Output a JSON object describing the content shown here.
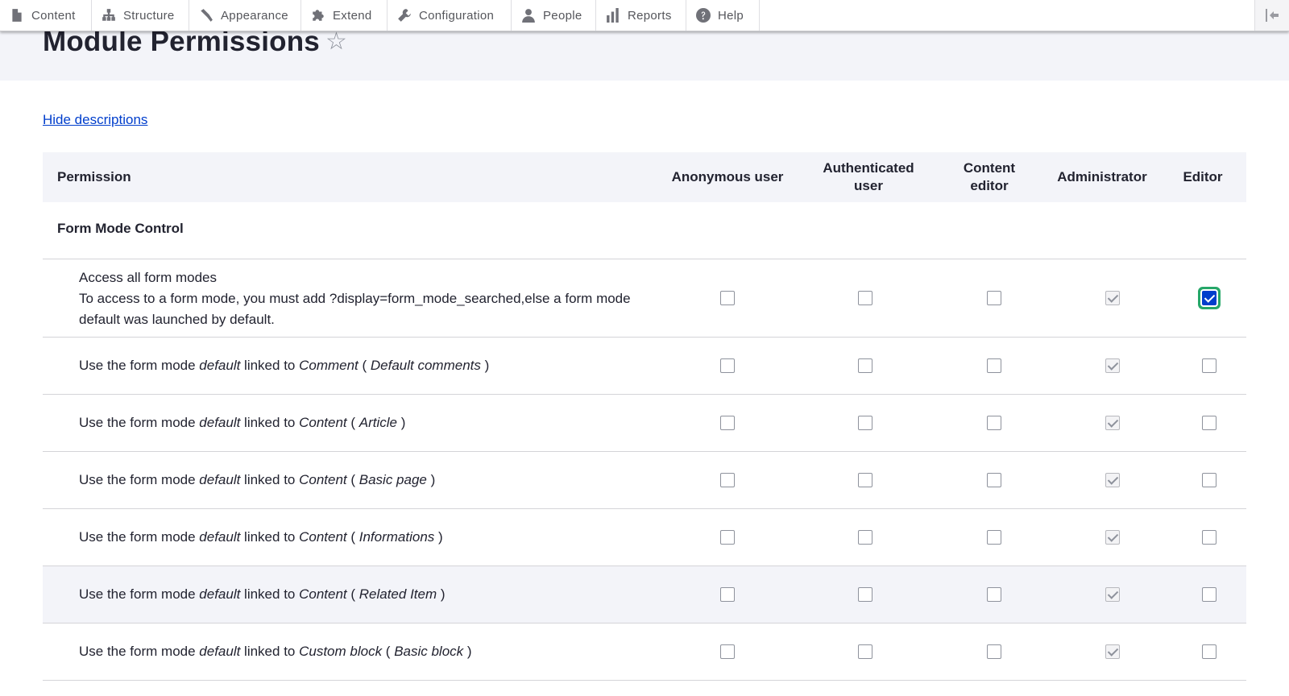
{
  "toolbar": {
    "items": [
      {
        "label": "Content",
        "icon": "file-icon"
      },
      {
        "label": "Structure",
        "icon": "sitemap-icon"
      },
      {
        "label": "Appearance",
        "icon": "brush-icon"
      },
      {
        "label": "Extend",
        "icon": "puzzle-icon"
      },
      {
        "label": "Configuration",
        "icon": "wrench-icon"
      },
      {
        "label": "People",
        "icon": "person-icon"
      },
      {
        "label": "Reports",
        "icon": "bar-chart-icon"
      },
      {
        "label": "Help",
        "icon": "help-icon"
      }
    ]
  },
  "page": {
    "title": "Module Permissions",
    "toggle_descriptions": "Hide descriptions"
  },
  "table": {
    "columns": {
      "permission": "Permission",
      "anonymous": "Anonymous user",
      "authenticated": "Authenticated user",
      "content_editor": "Content editor",
      "administrator": "Administrator",
      "editor": "Editor"
    },
    "group": "Form Mode Control",
    "rows": [
      {
        "title": "Access all form modes",
        "description": "To access to a form mode, you must add ?display=form_mode_searched,else a form mode default was launched by default.",
        "checks": [
          "unchecked",
          "unchecked",
          "unchecked",
          "disabled-checked",
          "checked"
        ]
      },
      {
        "prefix": "Use the form mode ",
        "mode": "default",
        "mid": " linked to ",
        "entity": "Comment",
        "bundle": "Default comments",
        "checks": [
          "unchecked",
          "unchecked",
          "unchecked",
          "disabled-checked",
          "unchecked"
        ]
      },
      {
        "prefix": "Use the form mode ",
        "mode": "default",
        "mid": " linked to ",
        "entity": "Content",
        "bundle": "Article",
        "checks": [
          "unchecked",
          "unchecked",
          "unchecked",
          "disabled-checked",
          "unchecked"
        ]
      },
      {
        "prefix": "Use the form mode ",
        "mode": "default",
        "mid": " linked to ",
        "entity": "Content",
        "bundle": "Basic page",
        "checks": [
          "unchecked",
          "unchecked",
          "unchecked",
          "disabled-checked",
          "unchecked"
        ]
      },
      {
        "prefix": "Use the form mode ",
        "mode": "default",
        "mid": " linked to ",
        "entity": "Content",
        "bundle": "Informations",
        "checks": [
          "unchecked",
          "unchecked",
          "unchecked",
          "disabled-checked",
          "unchecked"
        ]
      },
      {
        "prefix": "Use the form mode ",
        "mode": "default",
        "mid": " linked to ",
        "entity": "Content",
        "bundle": "Related Item",
        "checks": [
          "unchecked",
          "unchecked",
          "unchecked",
          "disabled-checked",
          "unchecked"
        ],
        "highlighted": true
      },
      {
        "prefix": "Use the form mode ",
        "mode": "default",
        "mid": " linked to ",
        "entity": "Custom block",
        "bundle": "Basic block",
        "checks": [
          "unchecked",
          "unchecked",
          "unchecked",
          "disabled-checked",
          "unchecked"
        ]
      }
    ]
  }
}
